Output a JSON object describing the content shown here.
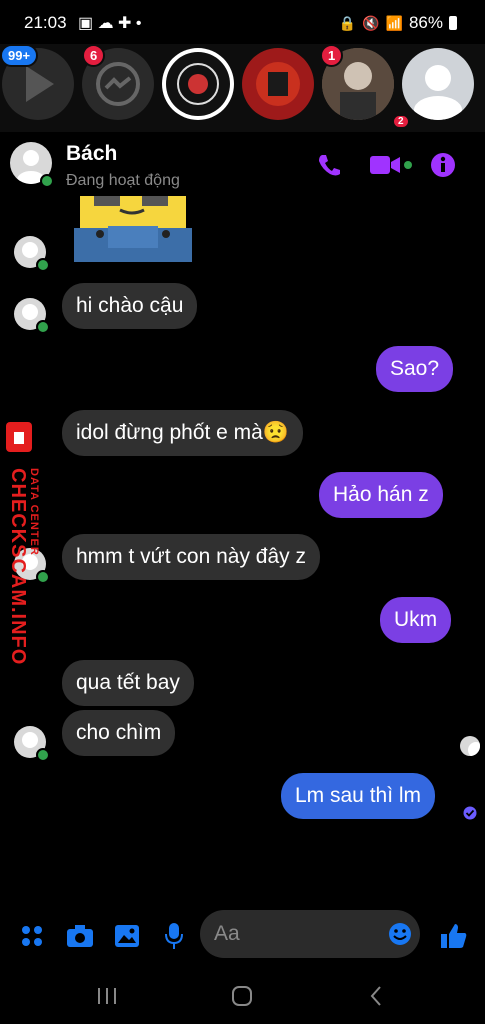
{
  "status_bar": {
    "time": "21:03",
    "battery": "86%"
  },
  "chat_heads": {
    "badges": [
      "99+",
      "6",
      "1"
    ],
    "bottom_badge": "2"
  },
  "header": {
    "contact_name": "Bách",
    "status_text": "Đang hoạt động"
  },
  "messages": [
    {
      "side": "in",
      "text": "hi chào cậu"
    },
    {
      "side": "out",
      "text": "Sao?"
    },
    {
      "side": "in",
      "text": "idol đừng phốt e mà😟"
    },
    {
      "side": "out",
      "text": "Hảo hán z"
    },
    {
      "side": "in",
      "text": "hmm t vứt con này đây z"
    },
    {
      "side": "out",
      "text": "Ukm"
    },
    {
      "side": "in",
      "text": "qua tết bay"
    },
    {
      "side": "in",
      "text": "cho chìm"
    },
    {
      "side": "out",
      "text": "Lm sau thì lm"
    }
  ],
  "composer": {
    "placeholder": "Aa"
  },
  "watermark": {
    "line1": "DATA CENTER",
    "line2": "CHECKSCAM.INFO"
  },
  "colors": {
    "accent": "#a033ff",
    "bubble_out": "#7b3fe4",
    "bubble_out_last": "#3468e0",
    "bubble_in": "#303030",
    "messenger_blue": "#1877f2"
  }
}
